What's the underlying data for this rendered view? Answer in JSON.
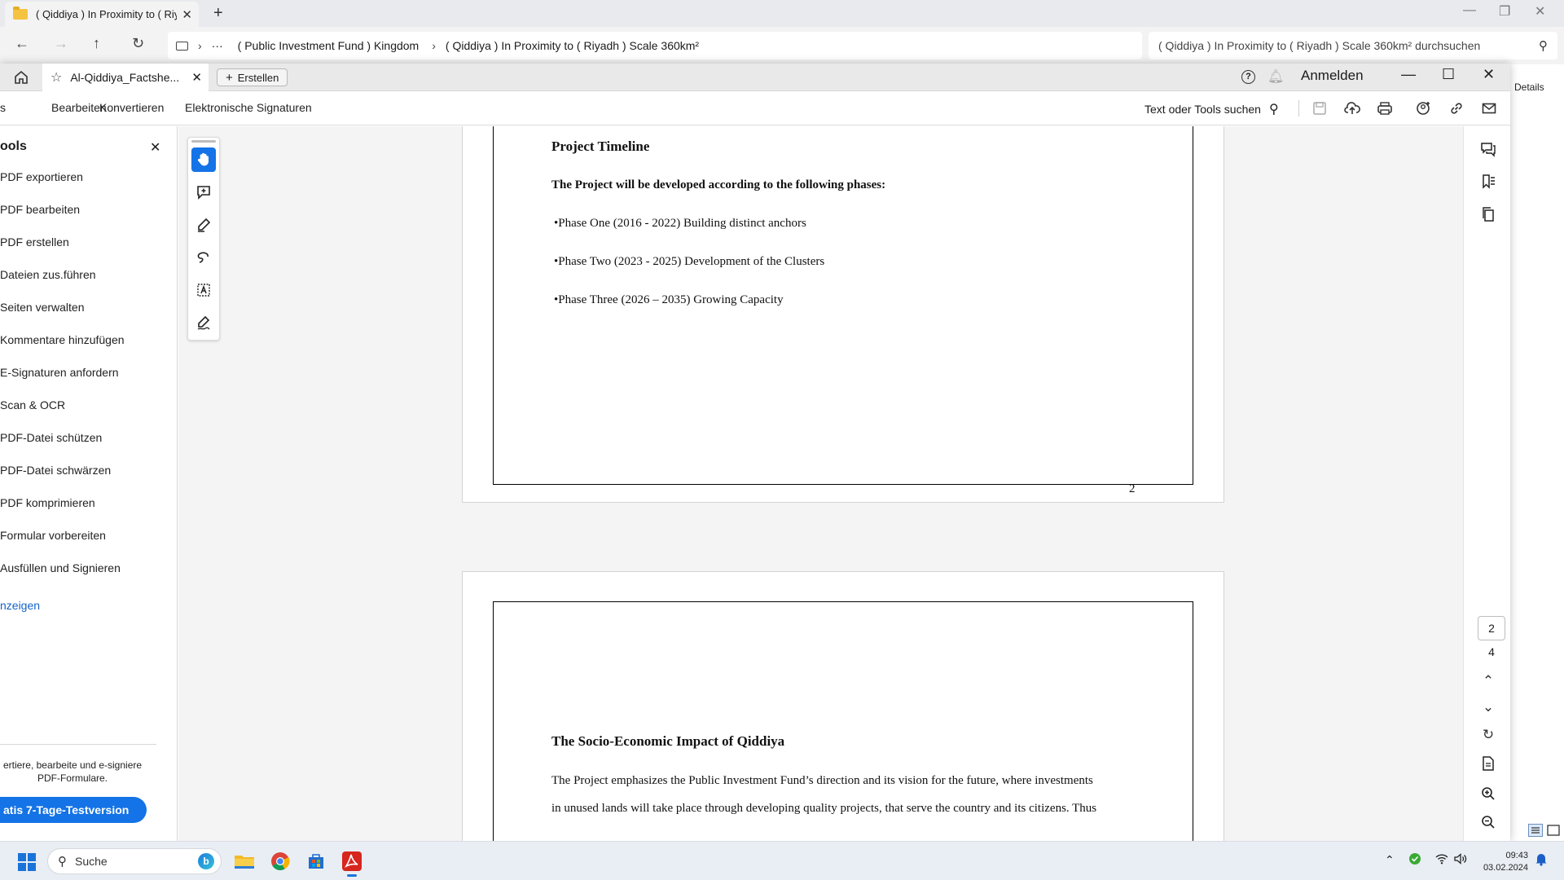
{
  "explorer": {
    "tab_title": "( Qiddiya ) In Proximity to ( Riy",
    "breadcrumb": [
      "( Public Investment Fund ) Kingdom",
      "( Qiddiya ) In Proximity to ( Riyadh ) Scale 360km²"
    ],
    "search_placeholder": "( Qiddiya ) In Proximity to ( Riyadh ) Scale 360km² durchsuchen",
    "details_label": "Details"
  },
  "acrobat": {
    "doc_tab_title": "Al-Qiddiya_Factshe...",
    "create_label": "Erstellen",
    "signin_label": "Anmelden",
    "menu": [
      "s",
      "Bearbeiten",
      "Konvertieren",
      "Elektronische Signaturen"
    ],
    "tool_search_label": "Text oder Tools suchen",
    "tools_panel": {
      "title": "ools",
      "items": [
        "PDF exportieren",
        "PDF bearbeiten",
        "PDF erstellen",
        "Dateien zus.führen",
        "Seiten verwalten",
        "Kommentare hinzufügen",
        "E-Signaturen anfordern",
        "Scan & OCR",
        "PDF-Datei schützen",
        "PDF-Datei schwärzen",
        "PDF komprimieren",
        "Formular vorbereiten",
        "Ausfüllen und Signieren"
      ],
      "show_more": "nzeigen",
      "promo": "ertiere, bearbeite und e-signiere PDF-Formulare.",
      "trial_button": "atis 7-Tage-Testversion"
    },
    "page2": {
      "heading": "Project Timeline",
      "intro": "The Project will be developed according to the following phases:",
      "phases": [
        "•Phase One (2016 - 2022) Building distinct anchors",
        "•Phase Two (2023 - 2025) Development of the Clusters",
        "•Phase Three (2026 – 2035) Growing Capacity"
      ],
      "page_number": "2"
    },
    "page3": {
      "heading": "The Socio-Economic Impact of Qiddiya",
      "lines": [
        "The Project emphasizes the Public Investment Fund’s direction and its vision for the future, where investments",
        "in unused lands will take place through developing quality projects, that serve the country and its citizens. Thus"
      ]
    },
    "page_nav": {
      "current": "2",
      "total": "4"
    }
  },
  "taskbar": {
    "search_label": "Suche",
    "time": "09:43",
    "date": "03.02.2024"
  }
}
